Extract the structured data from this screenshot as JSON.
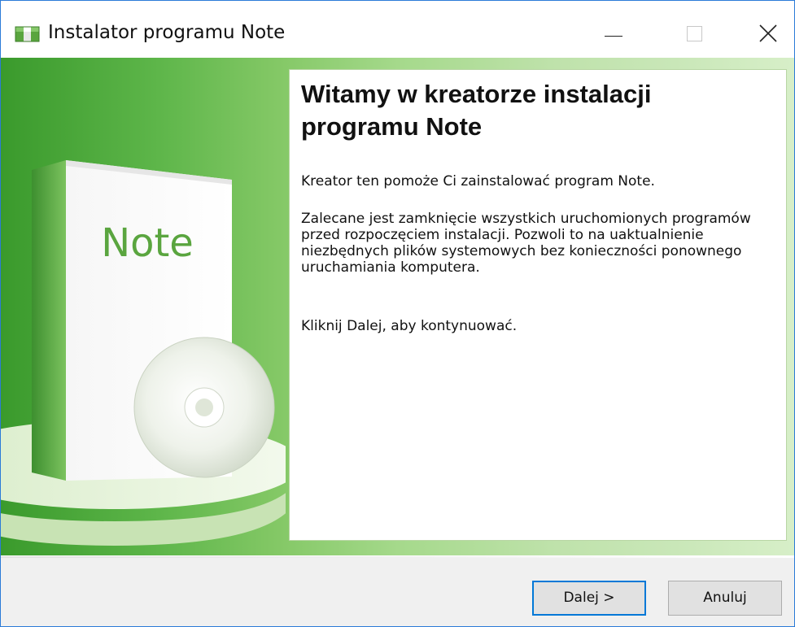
{
  "window": {
    "title": "Instalator programu Note"
  },
  "branding": {
    "box_label": "Note",
    "accent_color": "#5eb64a"
  },
  "main": {
    "heading": "Witamy w kreatorze instalacji programu Note",
    "paragraphs": [
      "Kreator ten pomoże Ci zainstalować program Note.",
      "Zalecane jest zamknięcie wszystkich uruchomionych programów przed rozpoczęciem instalacji. Pozwoli to na uaktualnienie niezbędnych plików systemowych bez konieczności ponownego uruchamiania komputera.",
      "Kliknij Dalej, aby kontynuować."
    ]
  },
  "footer": {
    "next_label": "Dalej >",
    "cancel_label": "Anuluj"
  },
  "icons": {
    "app": "installer-package-icon",
    "minimize": "minimize-icon",
    "maximize": "maximize-icon",
    "close": "close-icon"
  }
}
